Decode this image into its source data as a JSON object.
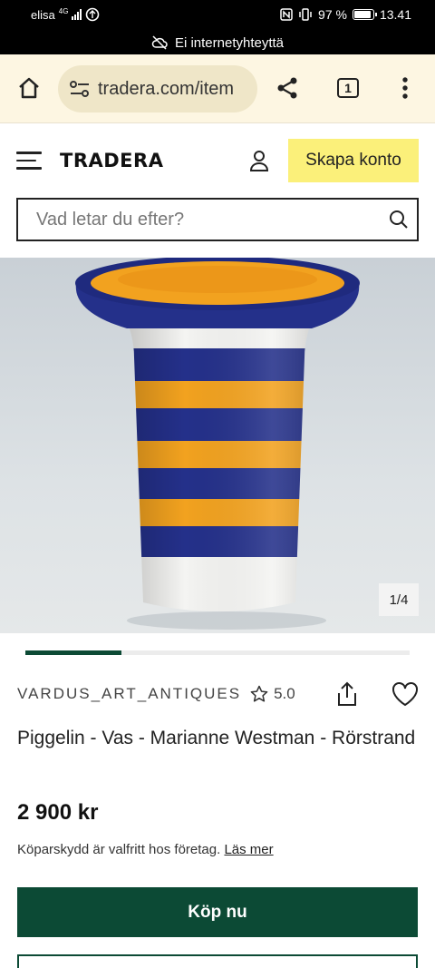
{
  "status_bar": {
    "carrier": "elisa",
    "network_badge": "4G",
    "battery_percent": "97 %",
    "battery_level": 0.97,
    "time": "13.41"
  },
  "offline_notice": "Ei internetyhteyttä",
  "browser": {
    "url": "tradera.com/item",
    "tab_count": "1",
    "icons": [
      "home-icon",
      "site-settings-icon",
      "share-icon",
      "tabs-icon",
      "more-icon"
    ]
  },
  "header": {
    "logo": "TRADERA",
    "signup_label": "Skapa konto"
  },
  "search": {
    "placeholder": "Vad letar du efter?"
  },
  "gallery": {
    "counter": "1/4",
    "current": 1,
    "total": 4
  },
  "seller": {
    "name": "VARDUS_ART_ANTIQUES",
    "rating": "5.0"
  },
  "product": {
    "title": "Piggelin - Vas - Marianne Westman - Rörstrand",
    "price": "2 900 kr",
    "buyer_protection_text": "Köparskydd är valfritt hos företag.",
    "read_more_link": "Läs mer",
    "buy_label": "Köp nu"
  },
  "colors": {
    "brand_green": "#0c4a35",
    "brand_yellow": "#fbf07a",
    "browser_bar": "#fdf6e2"
  }
}
